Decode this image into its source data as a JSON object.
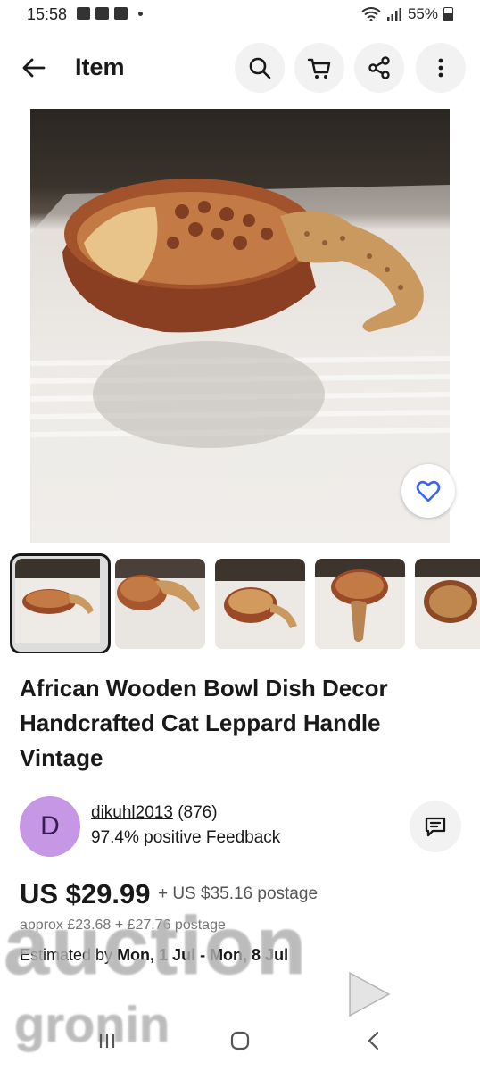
{
  "status_bar": {
    "time": "15:58",
    "battery": "55%"
  },
  "app_bar": {
    "title": "Item"
  },
  "product": {
    "title": "African Wooden Bowl Dish Decor Handcrafted Cat Leppard Handle Vintage",
    "thumbnail_count": 5
  },
  "seller": {
    "avatar_letter": "D",
    "avatar_color": "#c597e4",
    "name": "dikuhl2013",
    "rating": "(876)",
    "feedback": "97.4% positive Feedback"
  },
  "pricing": {
    "price": "US $29.99",
    "postage": "+ US $35.16 postage",
    "approx": "approx £23.68 + £27.76 postage",
    "estimate_label": "Estimated by",
    "estimate_dates": "Mon, 1 Jul - Mon, 8 Jul"
  },
  "watermark": {
    "line1": "auction",
    "line2": "gronin"
  },
  "icons": [
    "back-arrow-icon",
    "search-icon",
    "cart-icon",
    "share-icon",
    "more-icon",
    "heart-icon",
    "message-icon"
  ]
}
